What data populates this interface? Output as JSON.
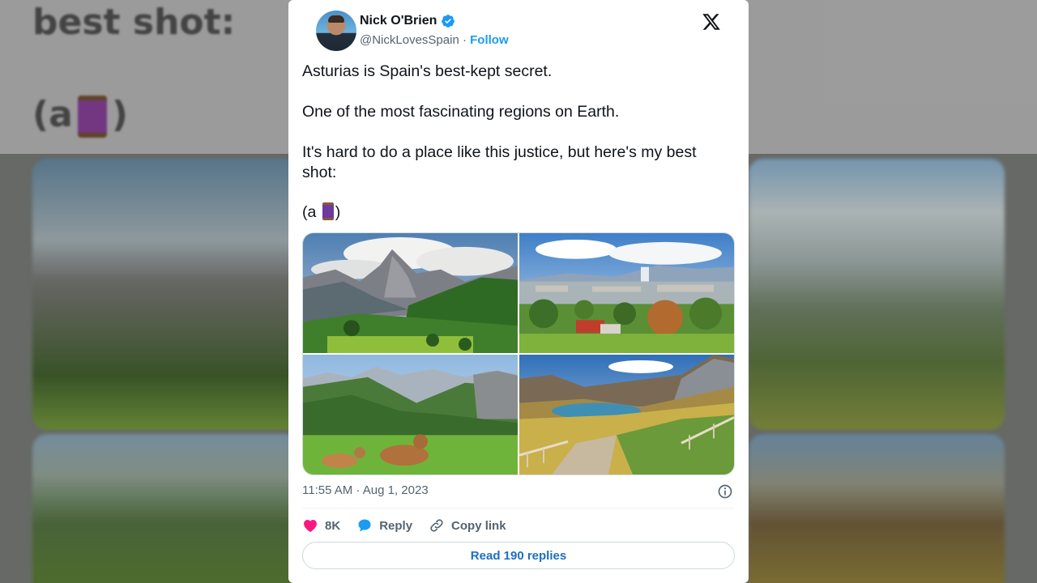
{
  "background": {
    "text_line1": "best shot:",
    "text_line2_prefix": "(a",
    "text_line2_suffix": ")"
  },
  "tweet": {
    "author_name": "Nick O'Brien",
    "handle": "@NickLovesSpain",
    "separator": " · ",
    "follow_label": "Follow",
    "paragraphs": [
      "Asturias is Spain's best-kept secret.",
      "One of the most fascinating regions on Earth.",
      "It's hard to do a place like this justice, but here's my best shot:"
    ],
    "thread_prefix": "(a",
    "thread_suffix": ")",
    "timestamp": "11:55 AM · Aug 1, 2023",
    "likes_count": "8K",
    "reply_label": "Reply",
    "copy_link_label": "Copy link",
    "read_replies_label": "Read 190 replies"
  },
  "icons": {
    "verified": "verified-badge-icon",
    "logo": "x-logo-icon",
    "info": "info-icon",
    "heart": "heart-icon",
    "reply": "speech-bubble-icon",
    "link": "link-icon",
    "thread": "thread-spool-icon"
  },
  "colors": {
    "accent": "#1d9bf0",
    "heart": "#f91880",
    "text": "#0f1419",
    "muted": "#536471"
  }
}
